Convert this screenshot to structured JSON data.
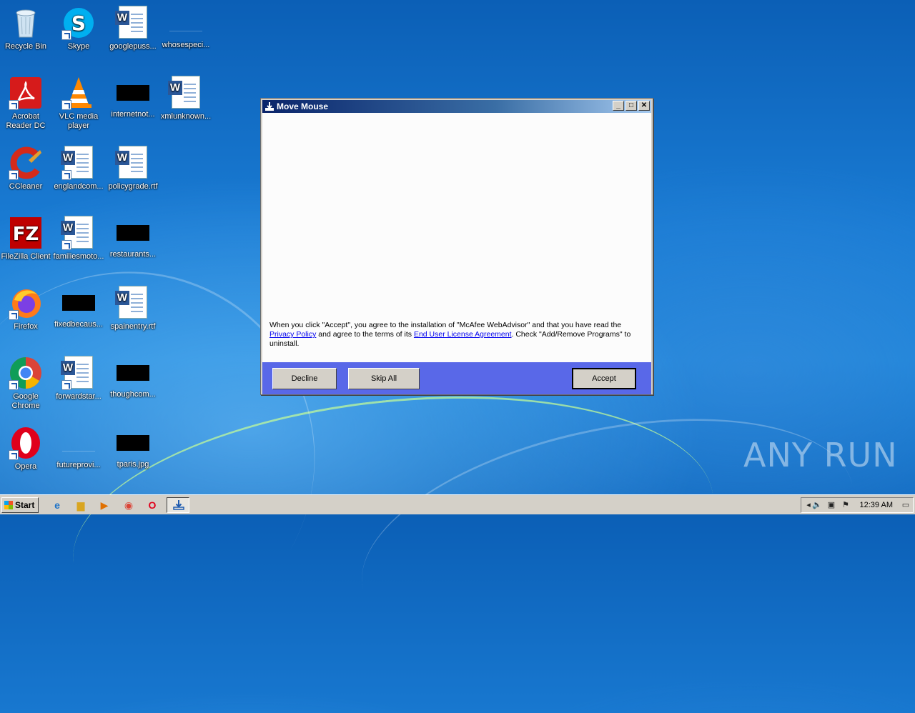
{
  "desktop": {
    "icons": [
      {
        "label": "Recycle Bin"
      },
      {
        "label": "Skype"
      },
      {
        "label": "googlepuss..."
      },
      {
        "label": "whosespeci..."
      },
      {
        "label": "Acrobat Reader DC"
      },
      {
        "label": "VLC media player"
      },
      {
        "label": "internetnot..."
      },
      {
        "label": "xmlunknown..."
      },
      {
        "label": "CCleaner"
      },
      {
        "label": "englandcom..."
      },
      {
        "label": "policygrade.rtf"
      },
      {
        "label": "FileZilla Client"
      },
      {
        "label": "familiesmoto..."
      },
      {
        "label": "restaurants..."
      },
      {
        "label": "Firefox"
      },
      {
        "label": "fixedbecaus..."
      },
      {
        "label": "spainentry.rtf"
      },
      {
        "label": "Google Chrome"
      },
      {
        "label": "forwardstar..."
      },
      {
        "label": "thoughcom..."
      },
      {
        "label": "Opera"
      },
      {
        "label": "futureprovi..."
      },
      {
        "label": "tparis.jpg"
      }
    ],
    "watermark": "ANY RUN"
  },
  "dialog": {
    "title": "Move Mouse",
    "agreement": {
      "part1": "When you click \"Accept\", you agree to the installation of \"McAfee WebAdvisor\" and that you have read the",
      "privacy_link": "Privacy Policy",
      "part2": " and agree to the terms of its ",
      "eula_link": "End User License Agreement",
      "part3": ". Check \"Add/Remove Programs\" to uninstall."
    },
    "buttons": {
      "decline": "Decline",
      "skip_all": "Skip All",
      "accept": "Accept"
    }
  },
  "taskbar": {
    "start_label": "Start",
    "clock": "12:39 AM"
  }
}
